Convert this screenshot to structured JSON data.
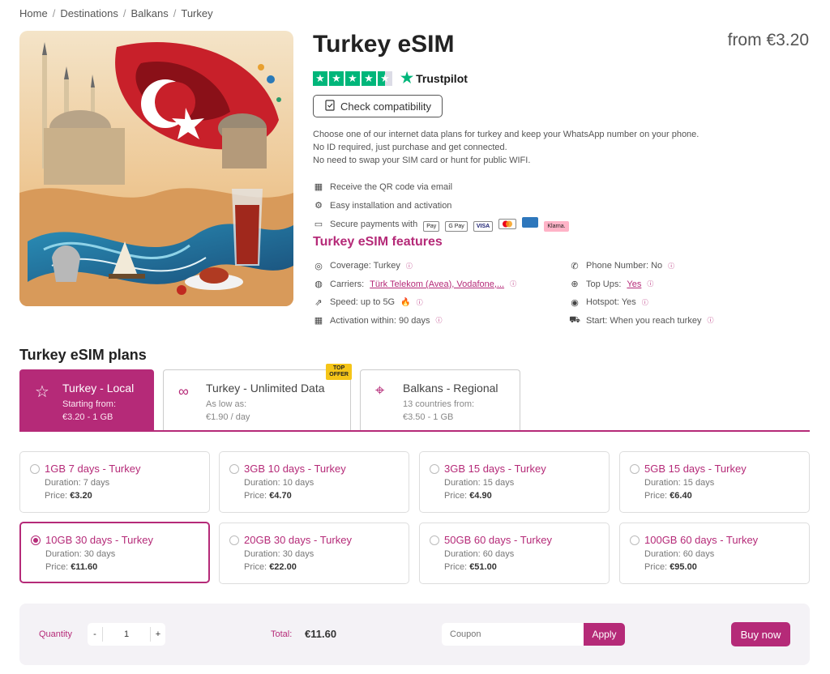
{
  "breadcrumb": [
    "Home",
    "Destinations",
    "Balkans",
    "Turkey"
  ],
  "product": {
    "title": "Turkey eSIM",
    "price_from": "from €3.20",
    "trustpilot_label": "Trustpilot",
    "check_compat": "Check compatibility",
    "description": [
      "Choose one of our internet data plans for turkey and keep your WhatsApp number on your phone.",
      "No ID required, just purchase and get connected.",
      "No need to swap your SIM card or hunt for public WIFI."
    ],
    "bullets": [
      {
        "icon": "qr-code-icon",
        "text": "Receive the QR code via email"
      },
      {
        "icon": "settings-icon",
        "text": "Easy installation and activation"
      },
      {
        "icon": "secure-card-icon",
        "text": "Secure payments with"
      }
    ],
    "payment_methods": [
      "Pay",
      "G Pay",
      "VISA",
      "mastercard",
      "AMEX",
      "Klarna."
    ]
  },
  "features": {
    "title": "Turkey eSIM features",
    "left": [
      {
        "icon": "globe-icon",
        "label": "Coverage: Turkey"
      },
      {
        "icon": "carrier-icon",
        "label": "Carriers: ",
        "link": "Türk Telekom (Avea), Vodafone,..."
      },
      {
        "icon": "speed-icon",
        "label": "Speed: up to 5G"
      },
      {
        "icon": "calendar-icon",
        "label": "Activation within: 90 days"
      }
    ],
    "right": [
      {
        "icon": "phone-icon",
        "label": "Phone Number: No"
      },
      {
        "icon": "topup-icon",
        "label": "Top Ups: ",
        "link": "Yes"
      },
      {
        "icon": "hotspot-icon",
        "label": "Hotspot: Yes"
      },
      {
        "icon": "start-icon",
        "label": "Start: When you reach turkey"
      }
    ]
  },
  "plans": {
    "title": "Turkey eSIM plans",
    "tabs": [
      {
        "title": "Turkey - Local",
        "sub1": "Starting from:",
        "sub2": "€3.20 - 1 GB"
      },
      {
        "title": "Turkey - Unlimited Data",
        "sub1": "As low as:",
        "sub2": "€1.90 / day",
        "badge": "TOP OFFER"
      },
      {
        "title": "Balkans - Regional",
        "sub1": "13 countries from:",
        "sub2": "€3.50 - 1 GB"
      }
    ],
    "cards": [
      {
        "name": "1GB 7 days - Turkey",
        "duration": "Duration: 7 days",
        "price_label": "Price: ",
        "price": "€3.20"
      },
      {
        "name": "3GB 10 days - Turkey",
        "duration": "Duration: 10 days",
        "price_label": "Price: ",
        "price": "€4.70"
      },
      {
        "name": "3GB 15 days - Turkey",
        "duration": "Duration: 15 days",
        "price_label": "Price: ",
        "price": "€4.90"
      },
      {
        "name": "5GB 15 days - Turkey",
        "duration": "Duration: 15 days",
        "price_label": "Price: ",
        "price": "€6.40"
      },
      {
        "name": "10GB 30 days - Turkey",
        "duration": "Duration: 30 days",
        "price_label": "Price: ",
        "price": "€11.60"
      },
      {
        "name": "20GB 30 days - Turkey",
        "duration": "Duration: 30 days",
        "price_label": "Price: ",
        "price": "€22.00"
      },
      {
        "name": "50GB 60 days - Turkey",
        "duration": "Duration: 60 days",
        "price_label": "Price: ",
        "price": "€51.00"
      },
      {
        "name": "100GB 60 days - Turkey",
        "duration": "Duration: 60 days",
        "price_label": "Price: ",
        "price": "€95.00"
      }
    ]
  },
  "checkout": {
    "quantity_label": "Quantity",
    "minus": "-",
    "plus": "+",
    "quantity": "1",
    "total_label": "Total:",
    "total": "€11.60",
    "coupon_placeholder": "Coupon",
    "apply": "Apply",
    "buy_now": "Buy now"
  },
  "colors": {
    "accent": "#b52a78",
    "trustpilot": "#00b67a"
  }
}
